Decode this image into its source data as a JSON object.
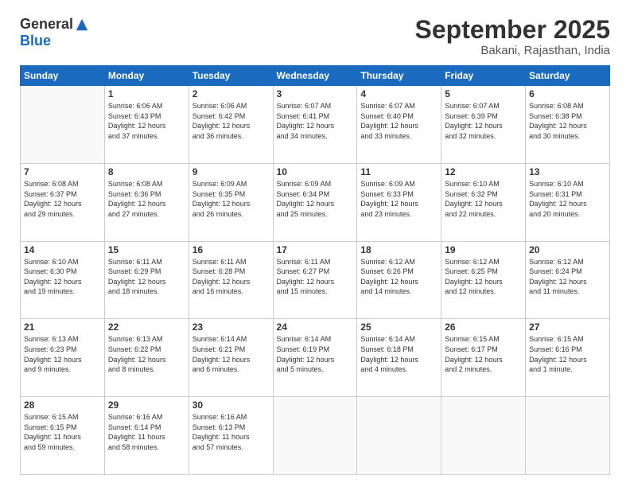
{
  "logo": {
    "general": "General",
    "blue": "Blue"
  },
  "header": {
    "title": "September 2025",
    "subtitle": "Bakani, Rajasthan, India"
  },
  "weekdays": [
    "Sunday",
    "Monday",
    "Tuesday",
    "Wednesday",
    "Thursday",
    "Friday",
    "Saturday"
  ],
  "weeks": [
    [
      {
        "day": "",
        "info": ""
      },
      {
        "day": "1",
        "info": "Sunrise: 6:06 AM\nSunset: 6:43 PM\nDaylight: 12 hours\nand 37 minutes."
      },
      {
        "day": "2",
        "info": "Sunrise: 6:06 AM\nSunset: 6:42 PM\nDaylight: 12 hours\nand 36 minutes."
      },
      {
        "day": "3",
        "info": "Sunrise: 6:07 AM\nSunset: 6:41 PM\nDaylight: 12 hours\nand 34 minutes."
      },
      {
        "day": "4",
        "info": "Sunrise: 6:07 AM\nSunset: 6:40 PM\nDaylight: 12 hours\nand 33 minutes."
      },
      {
        "day": "5",
        "info": "Sunrise: 6:07 AM\nSunset: 6:39 PM\nDaylight: 12 hours\nand 32 minutes."
      },
      {
        "day": "6",
        "info": "Sunrise: 6:08 AM\nSunset: 6:38 PM\nDaylight: 12 hours\nand 30 minutes."
      }
    ],
    [
      {
        "day": "7",
        "info": "Sunrise: 6:08 AM\nSunset: 6:37 PM\nDaylight: 12 hours\nand 29 minutes."
      },
      {
        "day": "8",
        "info": "Sunrise: 6:08 AM\nSunset: 6:36 PM\nDaylight: 12 hours\nand 27 minutes."
      },
      {
        "day": "9",
        "info": "Sunrise: 6:09 AM\nSunset: 6:35 PM\nDaylight: 12 hours\nand 26 minutes."
      },
      {
        "day": "10",
        "info": "Sunrise: 6:09 AM\nSunset: 6:34 PM\nDaylight: 12 hours\nand 25 minutes."
      },
      {
        "day": "11",
        "info": "Sunrise: 6:09 AM\nSunset: 6:33 PM\nDaylight: 12 hours\nand 23 minutes."
      },
      {
        "day": "12",
        "info": "Sunrise: 6:10 AM\nSunset: 6:32 PM\nDaylight: 12 hours\nand 22 minutes."
      },
      {
        "day": "13",
        "info": "Sunrise: 6:10 AM\nSunset: 6:31 PM\nDaylight: 12 hours\nand 20 minutes."
      }
    ],
    [
      {
        "day": "14",
        "info": "Sunrise: 6:10 AM\nSunset: 6:30 PM\nDaylight: 12 hours\nand 19 minutes."
      },
      {
        "day": "15",
        "info": "Sunrise: 6:11 AM\nSunset: 6:29 PM\nDaylight: 12 hours\nand 18 minutes."
      },
      {
        "day": "16",
        "info": "Sunrise: 6:11 AM\nSunset: 6:28 PM\nDaylight: 12 hours\nand 16 minutes."
      },
      {
        "day": "17",
        "info": "Sunrise: 6:11 AM\nSunset: 6:27 PM\nDaylight: 12 hours\nand 15 minutes."
      },
      {
        "day": "18",
        "info": "Sunrise: 6:12 AM\nSunset: 6:26 PM\nDaylight: 12 hours\nand 14 minutes."
      },
      {
        "day": "19",
        "info": "Sunrise: 6:12 AM\nSunset: 6:25 PM\nDaylight: 12 hours\nand 12 minutes."
      },
      {
        "day": "20",
        "info": "Sunrise: 6:12 AM\nSunset: 6:24 PM\nDaylight: 12 hours\nand 11 minutes."
      }
    ],
    [
      {
        "day": "21",
        "info": "Sunrise: 6:13 AM\nSunset: 6:23 PM\nDaylight: 12 hours\nand 9 minutes."
      },
      {
        "day": "22",
        "info": "Sunrise: 6:13 AM\nSunset: 6:22 PM\nDaylight: 12 hours\nand 8 minutes."
      },
      {
        "day": "23",
        "info": "Sunrise: 6:14 AM\nSunset: 6:21 PM\nDaylight: 12 hours\nand 6 minutes."
      },
      {
        "day": "24",
        "info": "Sunrise: 6:14 AM\nSunset: 6:19 PM\nDaylight: 12 hours\nand 5 minutes."
      },
      {
        "day": "25",
        "info": "Sunrise: 6:14 AM\nSunset: 6:18 PM\nDaylight: 12 hours\nand 4 minutes."
      },
      {
        "day": "26",
        "info": "Sunrise: 6:15 AM\nSunset: 6:17 PM\nDaylight: 12 hours\nand 2 minutes."
      },
      {
        "day": "27",
        "info": "Sunrise: 6:15 AM\nSunset: 6:16 PM\nDaylight: 12 hours\nand 1 minute."
      }
    ],
    [
      {
        "day": "28",
        "info": "Sunrise: 6:15 AM\nSunset: 6:15 PM\nDaylight: 11 hours\nand 59 minutes."
      },
      {
        "day": "29",
        "info": "Sunrise: 6:16 AM\nSunset: 6:14 PM\nDaylight: 11 hours\nand 58 minutes."
      },
      {
        "day": "30",
        "info": "Sunrise: 6:16 AM\nSunset: 6:13 PM\nDaylight: 11 hours\nand 57 minutes."
      },
      {
        "day": "",
        "info": ""
      },
      {
        "day": "",
        "info": ""
      },
      {
        "day": "",
        "info": ""
      },
      {
        "day": "",
        "info": ""
      }
    ]
  ]
}
